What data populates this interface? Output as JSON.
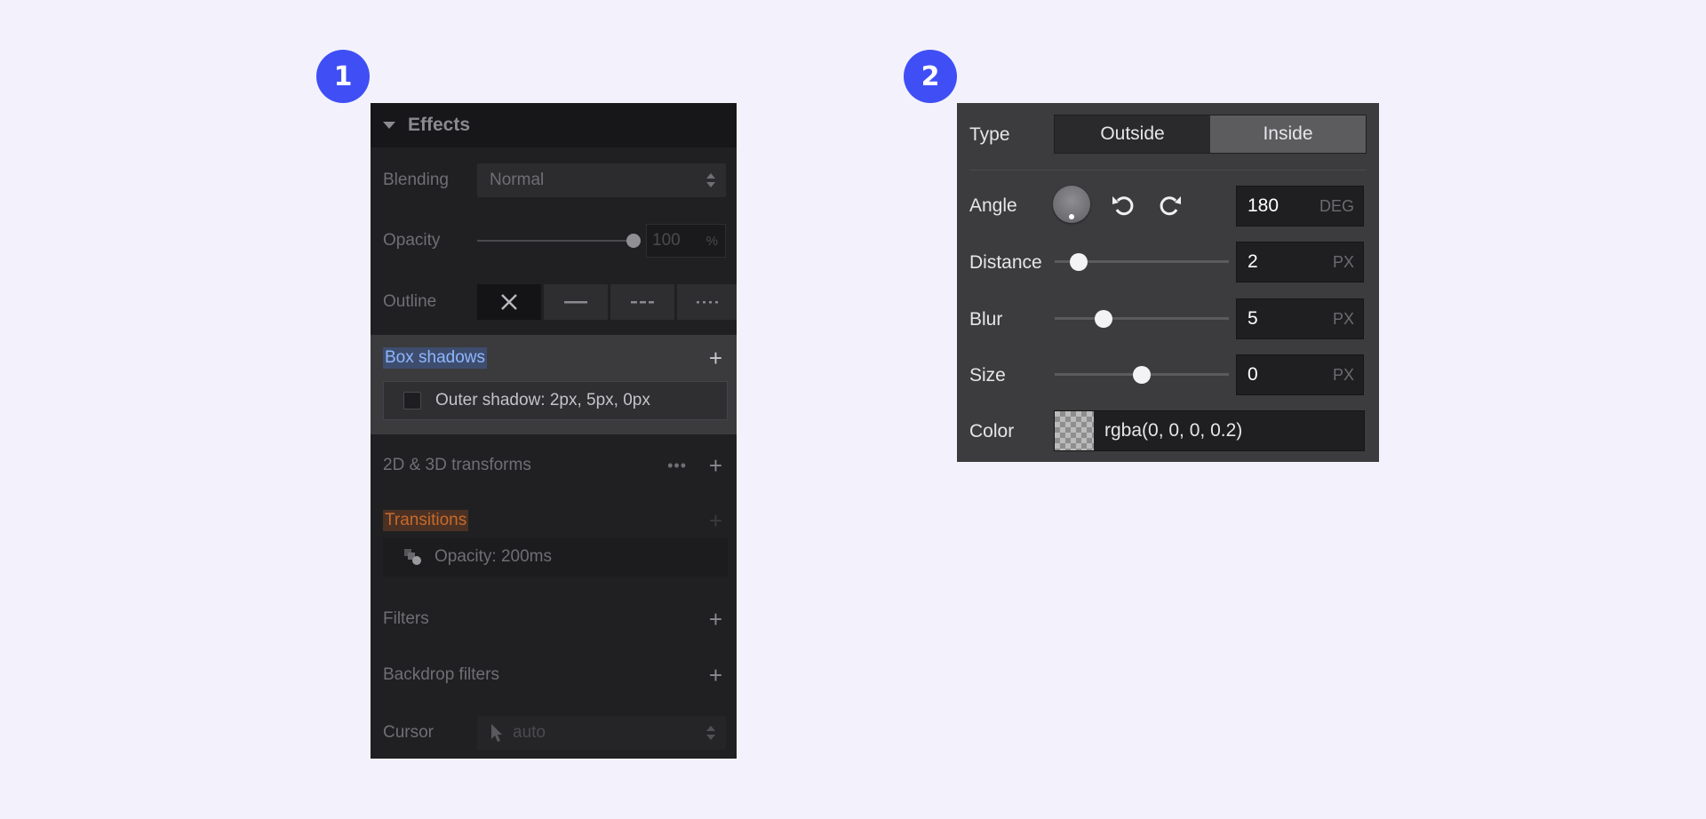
{
  "badges": [
    "1",
    "2"
  ],
  "panel1": {
    "header": "Effects",
    "blending": {
      "label": "Blending",
      "value": "Normal"
    },
    "opacity": {
      "label": "Opacity",
      "value": "100",
      "unit": "%",
      "level": 1.0
    },
    "outline": {
      "label": "Outline",
      "options": [
        "none",
        "solid",
        "dashed",
        "dotted"
      ],
      "selected": "none"
    },
    "box_shadows": {
      "label": "Box shadows",
      "item": "Outer shadow: 2px, 5px, 0px"
    },
    "transforms": {
      "label": "2D & 3D transforms"
    },
    "transitions": {
      "label": "Transitions",
      "item": "Opacity: 200ms"
    },
    "filters": {
      "label": "Filters"
    },
    "backdrop_filters": {
      "label": "Backdrop filters"
    },
    "cursor": {
      "label": "Cursor",
      "value": "auto"
    },
    "colors": {
      "highlight_blue": "#8eb6ff",
      "highlight_orange": "#c56a2c"
    }
  },
  "panel2": {
    "type": {
      "label": "Type",
      "options": [
        "Outside",
        "Inside"
      ],
      "selected": "Inside"
    },
    "angle": {
      "label": "Angle",
      "value": "180",
      "unit": "DEG"
    },
    "distance": {
      "label": "Distance",
      "value": "2",
      "unit": "PX",
      "level": 0.14
    },
    "blur": {
      "label": "Blur",
      "value": "5",
      "unit": "PX",
      "level": 0.28
    },
    "size": {
      "label": "Size",
      "value": "0",
      "unit": "PX",
      "level": 0.5
    },
    "color": {
      "label": "Color",
      "value": "rgba(0, 0, 0, 0.2)"
    }
  }
}
